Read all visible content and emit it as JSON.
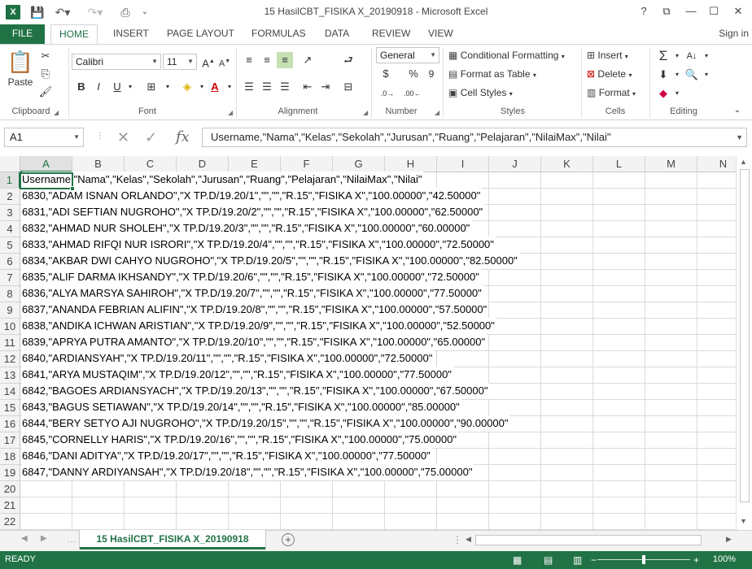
{
  "window": {
    "title": "15 HasilCBT_FISIKA X_20190918 - Microsoft Excel",
    "app_icon": "X",
    "help": "?",
    "min": "—",
    "max": "☐",
    "close": "✕"
  },
  "ribbon_tabs": [
    "FILE",
    "HOME",
    "INSERT",
    "PAGE LAYOUT",
    "FORMULAS",
    "DATA",
    "REVIEW",
    "VIEW"
  ],
  "active_tab": "HOME",
  "sign_in": "Sign in",
  "clipboard": {
    "paste": "Paste",
    "label": "Clipboard"
  },
  "font": {
    "name": "Calibri",
    "size": "11",
    "bold": "B",
    "italic": "I",
    "underline": "U",
    "label": "Font"
  },
  "alignment": {
    "label": "Alignment"
  },
  "number": {
    "format": "General",
    "currency": "$",
    "percent": "%",
    "comma": "9",
    "label": "Number"
  },
  "styles": {
    "conditional": "Conditional Formatting",
    "table": "Format as Table",
    "cell": "Cell Styles",
    "label": "Styles"
  },
  "cells": {
    "insert": "Insert",
    "delete": "Delete",
    "format": "Format",
    "label": "Cells"
  },
  "editing": {
    "label": "Editing"
  },
  "formula_bar": {
    "name_box": "A1",
    "fx": "fx",
    "content": "Username,\"Nama\",\"Kelas\",\"Sekolah\",\"Jurusan\",\"Ruang\",\"Pelajaran\",\"NilaiMax\",\"Nilai\""
  },
  "columns": [
    "A",
    "B",
    "C",
    "D",
    "E",
    "F",
    "G",
    "H",
    "I",
    "J",
    "K",
    "L",
    "M",
    "N"
  ],
  "rows": [
    {
      "n": "1",
      "text": "Username,\"Nama\",\"Kelas\",\"Sekolah\",\"Jurusan\",\"Ruang\",\"Pelajaran\",\"NilaiMax\",\"Nilai\""
    },
    {
      "n": "2",
      "text": "6830,\"ADAM ISNAN ORLANDO\",\"X TP.D/19.20/1\",\"\",\"\",\"R.15\",\"FISIKA X\",\"100.00000\",\"42.50000\""
    },
    {
      "n": "3",
      "text": "6831,\"ADI SEFTIAN NUGROHO\",\"X TP.D/19.20/2\",\"\",\"\",\"R.15\",\"FISIKA X\",\"100.00000\",\"62.50000\""
    },
    {
      "n": "4",
      "text": "6832,\"AHMAD NUR SHOLEH\",\"X TP.D/19.20/3\",\"\",\"\",\"R.15\",\"FISIKA X\",\"100.00000\",\"60.00000\""
    },
    {
      "n": "5",
      "text": "6833,\"AHMAD RIFQI NUR ISRORI\",\"X TP.D/19.20/4\",\"\",\"\",\"R.15\",\"FISIKA X\",\"100.00000\",\"72.50000\""
    },
    {
      "n": "6",
      "text": "6834,\"AKBAR DWI CAHYO NUGROHO\",\"X TP.D/19.20/5\",\"\",\"\",\"R.15\",\"FISIKA X\",\"100.00000\",\"82.50000\""
    },
    {
      "n": "7",
      "text": "6835,\"ALIF DARMA IKHSANDY\",\"X TP.D/19.20/6\",\"\",\"\",\"R.15\",\"FISIKA X\",\"100.00000\",\"72.50000\""
    },
    {
      "n": "8",
      "text": "6836,\"ALYA MARSYA SAHIROH\",\"X TP.D/19.20/7\",\"\",\"\",\"R.15\",\"FISIKA X\",\"100.00000\",\"77.50000\""
    },
    {
      "n": "9",
      "text": "6837,\"ANANDA FEBRIAN ALIFIN\",\"X TP.D/19.20/8\",\"\",\"\",\"R.15\",\"FISIKA X\",\"100.00000\",\"57.50000\""
    },
    {
      "n": "10",
      "text": "6838,\"ANDIKA ICHWAN ARISTIAN\",\"X TP.D/19.20/9\",\"\",\"\",\"R.15\",\"FISIKA X\",\"100.00000\",\"52.50000\""
    },
    {
      "n": "11",
      "text": "6839,\"APRYA PUTRA AMANTO\",\"X TP.D/19.20/10\",\"\",\"\",\"R.15\",\"FISIKA X\",\"100.00000\",\"65.00000\""
    },
    {
      "n": "12",
      "text": "6840,\"ARDIANSYAH\",\"X TP.D/19.20/11\",\"\",\"\",\"R.15\",\"FISIKA X\",\"100.00000\",\"72.50000\""
    },
    {
      "n": "13",
      "text": "6841,\"ARYA MUSTAQIM\",\"X TP.D/19.20/12\",\"\",\"\",\"R.15\",\"FISIKA X\",\"100.00000\",\"77.50000\""
    },
    {
      "n": "14",
      "text": "6842,\"BAGOES ARDIANSYACH\",\"X TP.D/19.20/13\",\"\",\"\",\"R.15\",\"FISIKA X\",\"100.00000\",\"67.50000\""
    },
    {
      "n": "15",
      "text": "6843,\"BAGUS SETIAWAN\",\"X TP.D/19.20/14\",\"\",\"\",\"R.15\",\"FISIKA X\",\"100.00000\",\"85.00000\""
    },
    {
      "n": "16",
      "text": "6844,\"BERY SETYO AJI NUGROHO\",\"X TP.D/19.20/15\",\"\",\"\",\"R.15\",\"FISIKA X\",\"100.00000\",\"90.00000\""
    },
    {
      "n": "17",
      "text": "6845,\"CORNELLY HARIS\",\"X TP.D/19.20/16\",\"\",\"\",\"R.15\",\"FISIKA X\",\"100.00000\",\"75.00000\""
    },
    {
      "n": "18",
      "text": "6846,\"DANI ADITYA\",\"X TP.D/19.20/17\",\"\",\"\",\"R.15\",\"FISIKA X\",\"100.00000\",\"77.50000\""
    },
    {
      "n": "19",
      "text": "6847,\"DANNY ARDIYANSAH\",\"X TP.D/19.20/18\",\"\",\"\",\"R.15\",\"FISIKA X\",\"100.00000\",\"75.00000\""
    },
    {
      "n": "20",
      "text": ""
    },
    {
      "n": "21",
      "text": ""
    },
    {
      "n": "22",
      "text": ""
    }
  ],
  "sheet_tab": "15 HasilCBT_FISIKA X_20190918",
  "add_sheet": "+",
  "status": {
    "ready": "READY",
    "zoom": "100%",
    "zoom_level": 0.5,
    "minus": "−",
    "plus": "+"
  }
}
